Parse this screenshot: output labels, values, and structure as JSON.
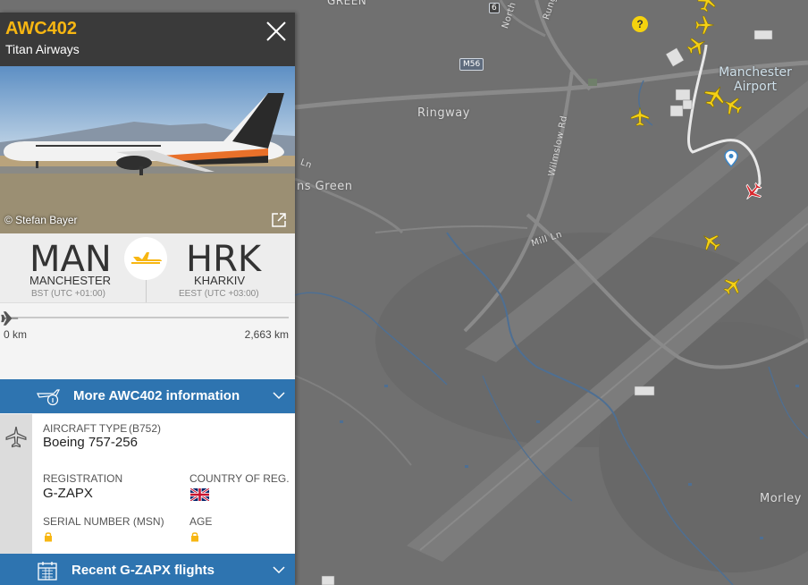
{
  "map": {
    "labels": {
      "top_label": "GREEN",
      "ringway": "Ringway",
      "ns_green": "ns Green",
      "wilmslow_rd": "Wilmslow Rd",
      "mill_ln": "Mill Ln",
      "north": "North",
      "rung": "Rung",
      "lane_frag": "Ln",
      "morley": "Morley",
      "m56": "M56",
      "marker_6": "6",
      "airport": "Manchester Airport"
    }
  },
  "panel": {
    "flight_code": "AWC402",
    "airline": "Titan Airways",
    "photo_credit": "© Stefan Bayer",
    "origin": {
      "iata": "MAN",
      "city": "MANCHESTER",
      "tz": "BST (UTC +01:00)"
    },
    "destination": {
      "iata": "HRK",
      "city": "KHARKIV",
      "tz": "EEST (UTC +03:00)"
    },
    "progress": {
      "fraction": 0.0,
      "left_label": "0 km",
      "right_label": "2,663 km"
    },
    "more_info_label": "More AWC402 information",
    "aircraft": {
      "type_label": "AIRCRAFT TYPE",
      "type_code": "(B752)",
      "type_value": "Boeing 757-256",
      "registration_label": "REGISTRATION",
      "registration_value": "G-ZAPX",
      "country_label": "COUNTRY OF REG.",
      "serial_label": "SERIAL NUMBER (MSN)",
      "age_label": "AGE"
    },
    "recent_flights_label": "Recent G-ZAPX flights"
  },
  "colors": {
    "accent": "#f7b612",
    "bar_blue": "#2e74b0",
    "selected_plane": "#d8272d"
  }
}
